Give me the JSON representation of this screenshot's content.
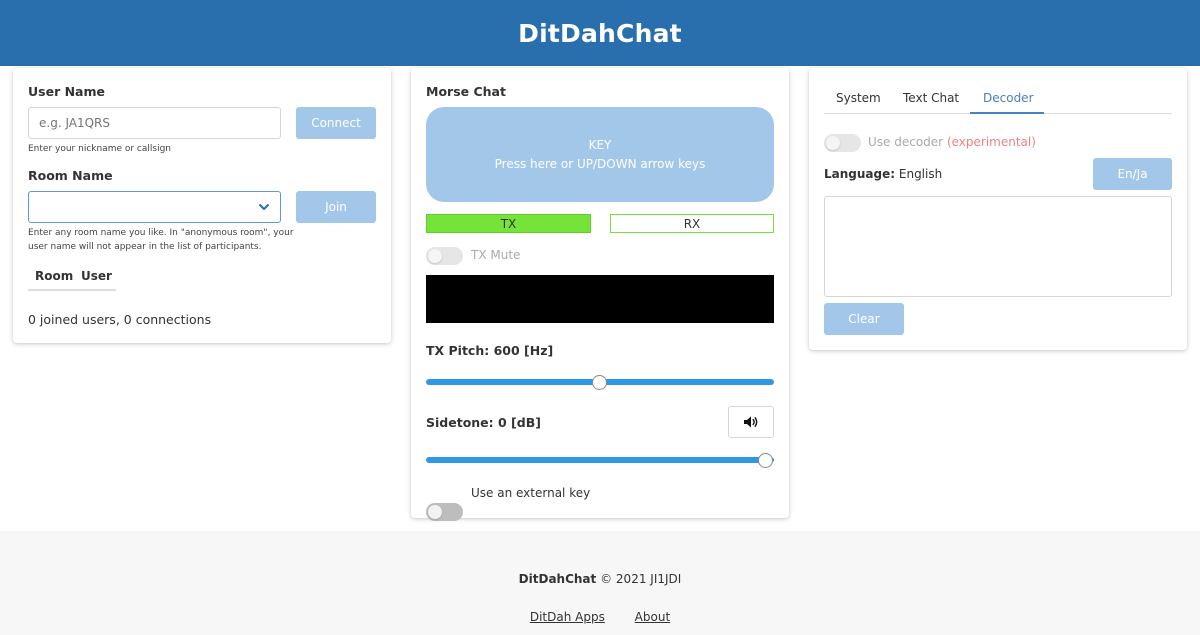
{
  "header": {
    "title": "DitDahChat"
  },
  "left": {
    "user_name_label": "User Name",
    "user_name_placeholder": "e.g. JA1QRS",
    "user_name_help": "Enter your nickname or callsign",
    "connect_label": "Connect",
    "room_name_label": "Room Name",
    "room_help_1": "Enter any room name you like. In \"anonymous room\", your",
    "room_help_2": "user name will not appear in the list of participants.",
    "join_label": "Join",
    "tabs": [
      "Room",
      "User"
    ],
    "status": "0 joined users, 0 connections"
  },
  "mid": {
    "title": "Morse Chat",
    "key_title": "KEY",
    "key_hint": "Press here or UP/DOWN arrow keys",
    "tx_label": "TX",
    "rx_label": "RX",
    "tx_mute_label": "TX Mute",
    "tx_pitch_label": "TX Pitch: 600 [Hz]",
    "tx_pitch_value": 600,
    "sidetone_label": "Sidetone: 0 [dB]",
    "sidetone_value": 0,
    "external_key_label": "Use an external key",
    "accent_color": "#2f98e6",
    "tx_color": "#76e33b"
  },
  "right": {
    "tabs": [
      "System",
      "Text Chat",
      "Decoder"
    ],
    "active_tab": "Decoder",
    "use_decoder_label": "Use decoder",
    "experimental_label": "(experimental)",
    "language_label": "Language:",
    "language_value": "English",
    "en_ja_label": "En/Ja",
    "clear_label": "Clear"
  },
  "footer": {
    "brand": "DitDahChat",
    "copyright": "© 2021 JI1JDI",
    "links": [
      "DitDah Apps",
      "About"
    ]
  },
  "icons": {
    "chevron": "chevron-down-icon",
    "speaker": "speaker-icon"
  }
}
